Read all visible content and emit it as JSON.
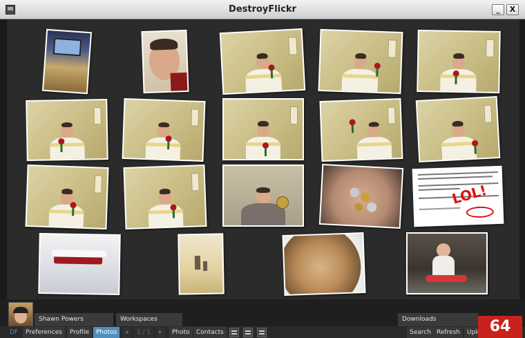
{
  "window": {
    "title": "DestroyFlickr",
    "minimize_label": "_",
    "close_label": "X"
  },
  "user": {
    "name": "Shawn Powers"
  },
  "panels": {
    "workspaces": "Workspaces",
    "downloads": "Downloads"
  },
  "toolbar": {
    "df_label": "DF",
    "preferences": "Preferences",
    "profile": "Profile",
    "photos": "Photos",
    "prev": "◂",
    "page_indicator": "1 / 1",
    "next": "▸",
    "photo": "Photo",
    "contacts": "Contacts",
    "search": "Search",
    "refresh": "Refresh",
    "upload": "Uplo"
  },
  "page_number": "64",
  "photo_caption": {
    "lol": "LOL!"
  },
  "colors": {
    "accent": "#4f8fbf",
    "badge": "#c8221d",
    "canvas": "#2b2b2b"
  }
}
